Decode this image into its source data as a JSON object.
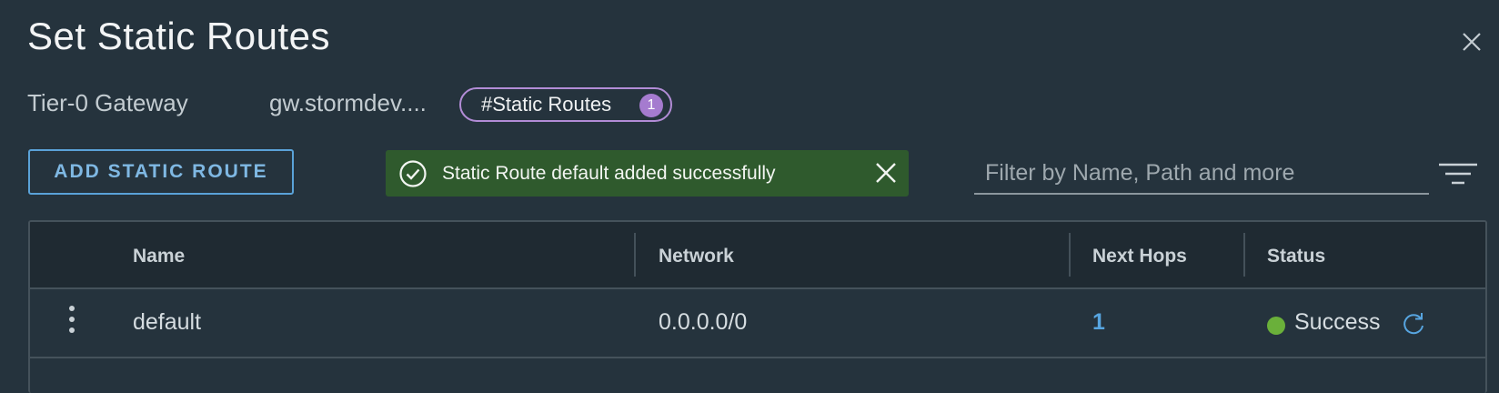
{
  "dialog": {
    "title": "Set Static Routes",
    "gateway_type": "Tier-0 Gateway",
    "gateway_name": "gw.stormdev....",
    "pill_label": "#Static Routes",
    "pill_count": "1"
  },
  "toolbar": {
    "add_label": "ADD STATIC ROUTE",
    "filter_placeholder": "Filter by Name, Path and more"
  },
  "toast": {
    "message": "Static Route default added successfully",
    "color": "#2f5a2d"
  },
  "table": {
    "headers": [
      "Name",
      "Network",
      "Next Hops",
      "Status"
    ],
    "rows": [
      {
        "name": "default",
        "network": "0.0.0.0/0",
        "next_hops": "1",
        "status": "Success"
      }
    ]
  },
  "colors": {
    "background": "#25333d",
    "accent": "#5aa2d8",
    "success": "#6ab03a",
    "badge": "#a57bcf"
  }
}
